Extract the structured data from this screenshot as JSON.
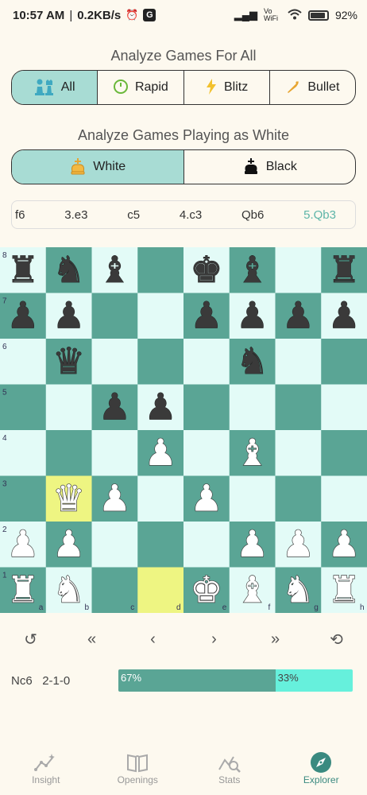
{
  "status_bar": {
    "time": "10:57 AM",
    "speed": "0.2KB/s",
    "battery": "92%",
    "icons": [
      "alarm-icon",
      "g-app-icon",
      "signal-icon",
      "vowifi-icon",
      "wifi-icon",
      "battery-icon"
    ],
    "vowifi_label": "Vo WiFi",
    "g_label": "G"
  },
  "time_filter": {
    "title": "Analyze Games For All",
    "options": [
      {
        "label": "All",
        "icon": "pawn-pair-icon"
      },
      {
        "label": "Rapid",
        "icon": "clock-icon"
      },
      {
        "label": "Blitz",
        "icon": "lightning-icon"
      },
      {
        "label": "Bullet",
        "icon": "bullet-icon"
      }
    ],
    "selected": "All"
  },
  "color_filter": {
    "title": "Analyze Games Playing as White",
    "options": [
      {
        "label": "White",
        "icon": "white-king-icon"
      },
      {
        "label": "Black",
        "icon": "black-king-icon"
      }
    ],
    "selected": "White"
  },
  "moves": [
    "f6",
    "3.e3",
    "c5",
    "4.c3",
    "Qb6",
    "5.Qb3"
  ],
  "current_move": "5.Qb3",
  "board": {
    "light_color": "#e3fbf7",
    "dark_color": "#5aa595",
    "highlight_color": "#eef582",
    "files": [
      "a",
      "b",
      "c",
      "d",
      "e",
      "f",
      "g",
      "h"
    ],
    "ranks": [
      "1",
      "2",
      "3",
      "4",
      "5",
      "6",
      "7",
      "8"
    ],
    "highlights": [
      "b3",
      "d1"
    ],
    "pieces": [
      {
        "sq": "a8",
        "p": "r"
      },
      {
        "sq": "b8",
        "p": "n"
      },
      {
        "sq": "c8",
        "p": "b"
      },
      {
        "sq": "e8",
        "p": "k"
      },
      {
        "sq": "f8",
        "p": "b"
      },
      {
        "sq": "h8",
        "p": "r"
      },
      {
        "sq": "a7",
        "p": "p"
      },
      {
        "sq": "b7",
        "p": "p"
      },
      {
        "sq": "e7",
        "p": "p"
      },
      {
        "sq": "f7",
        "p": "p"
      },
      {
        "sq": "g7",
        "p": "p"
      },
      {
        "sq": "h7",
        "p": "p"
      },
      {
        "sq": "b6",
        "p": "q"
      },
      {
        "sq": "f6",
        "p": "n"
      },
      {
        "sq": "c5",
        "p": "p"
      },
      {
        "sq": "d5",
        "p": "p"
      },
      {
        "sq": "d4",
        "p": "P"
      },
      {
        "sq": "f4",
        "p": "B"
      },
      {
        "sq": "b3",
        "p": "Q"
      },
      {
        "sq": "c3",
        "p": "P"
      },
      {
        "sq": "e3",
        "p": "P"
      },
      {
        "sq": "a2",
        "p": "P"
      },
      {
        "sq": "b2",
        "p": "P"
      },
      {
        "sq": "f2",
        "p": "P"
      },
      {
        "sq": "g2",
        "p": "P"
      },
      {
        "sq": "h2",
        "p": "P"
      },
      {
        "sq": "a1",
        "p": "R"
      },
      {
        "sq": "b1",
        "p": "N"
      },
      {
        "sq": "e1",
        "p": "K"
      },
      {
        "sq": "f1",
        "p": "B"
      },
      {
        "sq": "g1",
        "p": "N"
      },
      {
        "sq": "h1",
        "p": "R"
      }
    ]
  },
  "navigation": {
    "reset": "↺",
    "first": "«",
    "prev": "‹",
    "next": "›",
    "last": "»",
    "flip": "⟲"
  },
  "stats": {
    "move": "Nc6",
    "record": "2-1-0",
    "win_pct": 67,
    "win_label": "67%",
    "loss_label": "33%"
  },
  "tabs": [
    {
      "label": "Insight",
      "icon": "insight-icon"
    },
    {
      "label": "Openings",
      "icon": "book-icon"
    },
    {
      "label": "Stats",
      "icon": "stats-icon"
    },
    {
      "label": "Explorer",
      "icon": "compass-icon"
    }
  ],
  "active_tab": "Explorer"
}
